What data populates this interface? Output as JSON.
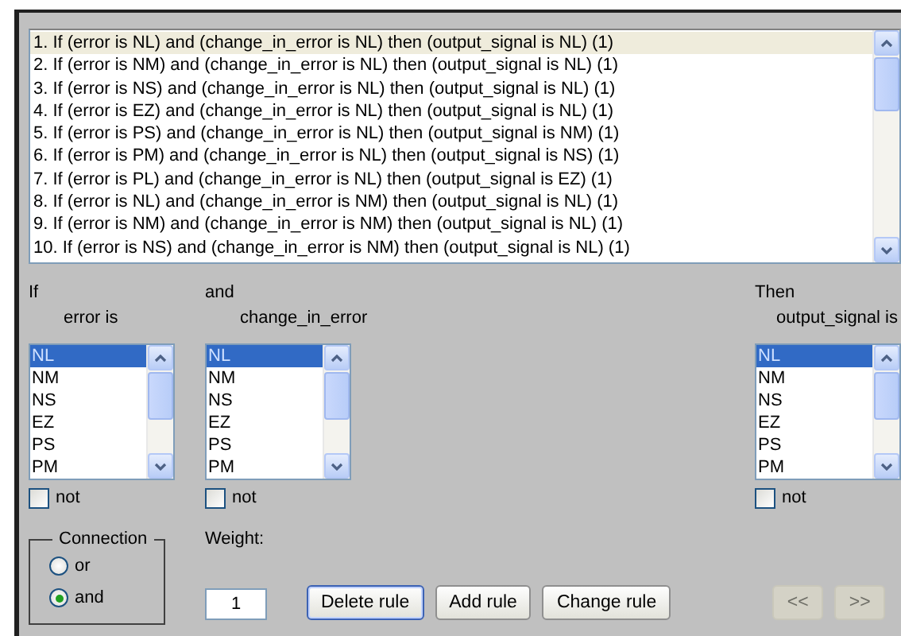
{
  "rules": [
    {
      "text": "1. If (error is NL) and (change_in_error is NL) then (output_signal is NL) (1)",
      "selected": true
    },
    {
      "text": "2. If (error is NM) and (change_in_error is NL) then (output_signal is NL) (1)",
      "selected": false
    },
    {
      "text": "3. If (error is NS) and (change_in_error is NL) then (output_signal is NL) (1)",
      "selected": false
    },
    {
      "text": "4. If (error is EZ) and (change_in_error is NL) then (output_signal is NL) (1)",
      "selected": false
    },
    {
      "text": "5. If (error is PS) and (change_in_error is NL) then (output_signal is NM) (1)",
      "selected": false
    },
    {
      "text": "6. If (error is PM) and (change_in_error is NL) then (output_signal is NS) (1)",
      "selected": false
    },
    {
      "text": "7. If (error is PL) and (change_in_error is NL) then (output_signal is EZ) (1)",
      "selected": false
    },
    {
      "text": "8. If (error is NL) and (change_in_error is NM) then (output_signal is NL) (1)",
      "selected": false
    },
    {
      "text": "9. If (error is NM) and (change_in_error is NM) then (output_signal is NL) (1)",
      "selected": false
    },
    {
      "text": "10. If (error is NS) and (change_in_error is NM) then (output_signal is NL) (1)",
      "selected": false
    }
  ],
  "variables": [
    {
      "heading": "If",
      "label": "error is",
      "items": [
        {
          "text": "NL",
          "selected": true
        },
        {
          "text": "NM",
          "selected": false
        },
        {
          "text": "NS",
          "selected": false
        },
        {
          "text": "EZ",
          "selected": false
        },
        {
          "text": "PS",
          "selected": false
        },
        {
          "text": "PM",
          "selected": false
        }
      ],
      "not_label": "not",
      "not_checked": false
    },
    {
      "heading": "and",
      "label": "change_in_error",
      "items": [
        {
          "text": "NL",
          "selected": true
        },
        {
          "text": "NM",
          "selected": false
        },
        {
          "text": "NS",
          "selected": false
        },
        {
          "text": "EZ",
          "selected": false
        },
        {
          "text": "PS",
          "selected": false
        },
        {
          "text": "PM",
          "selected": false
        }
      ],
      "not_label": "not",
      "not_checked": false
    },
    {
      "heading": "Then",
      "label": "output_signal is",
      "items": [
        {
          "text": "NL",
          "selected": true
        },
        {
          "text": "NM",
          "selected": false
        },
        {
          "text": "NS",
          "selected": false
        },
        {
          "text": "EZ",
          "selected": false
        },
        {
          "text": "PS",
          "selected": false
        },
        {
          "text": "PM",
          "selected": false
        }
      ],
      "not_label": "not",
      "not_checked": false
    }
  ],
  "connection": {
    "title": "Connection",
    "options": [
      {
        "label": "or",
        "selected": false
      },
      {
        "label": "and",
        "selected": true
      }
    ]
  },
  "weight": {
    "label": "Weight:",
    "value": "1"
  },
  "buttons": [
    {
      "label": "Delete rule",
      "disabled": false,
      "focused": true
    },
    {
      "label": "Add rule",
      "disabled": false,
      "focused": false
    },
    {
      "label": "Change rule",
      "disabled": false,
      "focused": false
    },
    {
      "label": "<<",
      "disabled": true,
      "focused": false
    },
    {
      "label": ">>",
      "disabled": true,
      "focused": false
    }
  ]
}
